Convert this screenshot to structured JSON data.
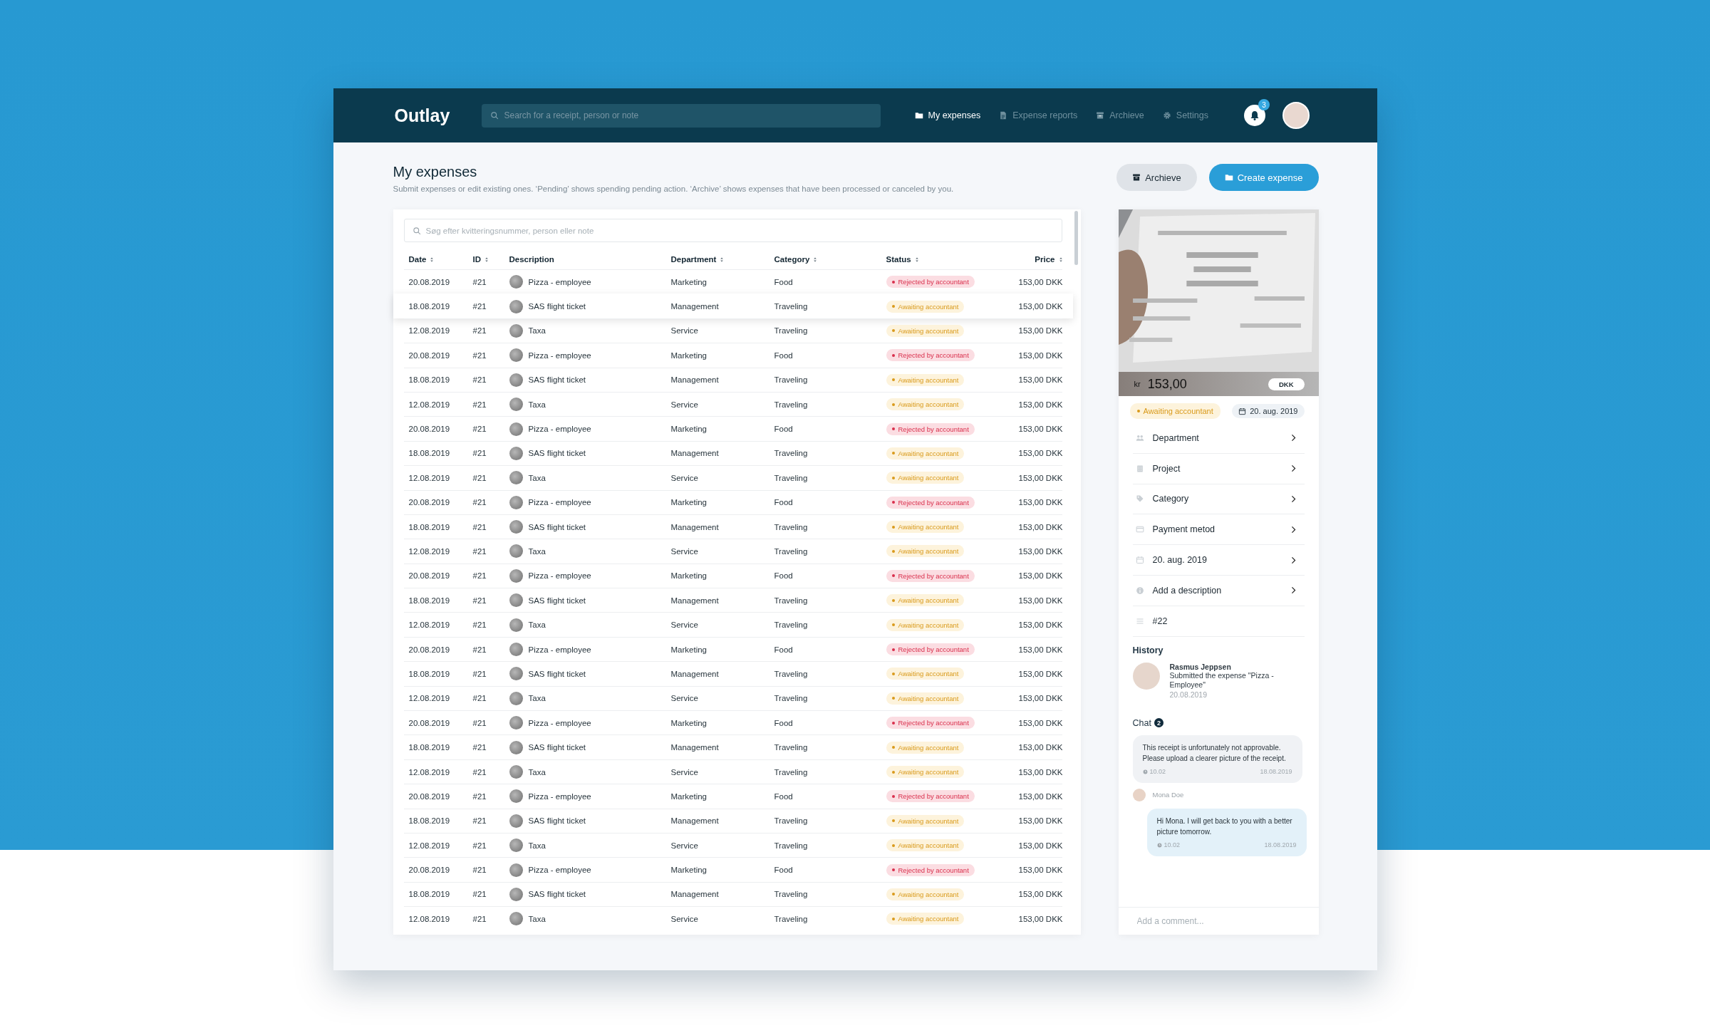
{
  "app": {
    "logo": "Outlay",
    "search_placeholder": "Search for a receipt, person or note",
    "nav": [
      {
        "label": "My expenses",
        "selected": true
      },
      {
        "label": "Expense reports",
        "selected": false
      },
      {
        "label": "Archieve",
        "selected": false
      },
      {
        "label": "Settings",
        "selected": false
      }
    ],
    "notifications": "3"
  },
  "page": {
    "title": "My expenses",
    "subtitle": "Submit expenses or edit existing ones. ‘Pending’ shows spending pending action. ‘Archive’ shows expenses that have been processed or canceled by you.",
    "buttons": [
      {
        "label": "Archieve",
        "kind": "secondary"
      },
      {
        "label": "Create expense",
        "kind": "primary"
      }
    ]
  },
  "table": {
    "search_placeholder": "Søg efter kvitteringsnummer, person eller note",
    "columns": [
      {
        "label": "Date",
        "sortable": true
      },
      {
        "label": "ID",
        "sortable": true
      },
      {
        "label": "Description",
        "sortable": false
      },
      {
        "label": "Department",
        "sortable": true
      },
      {
        "label": "Category",
        "sortable": true
      },
      {
        "label": "Status",
        "sortable": true
      },
      {
        "label": "Price",
        "sortable": true
      }
    ],
    "rows": [
      {
        "date": "20.08.2019",
        "id": "#21",
        "description": "Pizza - employee",
        "department": "Marketing",
        "category": "Food",
        "status": {
          "label": "Rejected by accountant",
          "kind": "rejected"
        },
        "price": "153,00 DKK",
        "selected": false
      },
      {
        "date": "18.08.2019",
        "id": "#21",
        "description": "SAS flight ticket",
        "department": "Management",
        "category": "Traveling",
        "status": {
          "label": "Awaiting accountant",
          "kind": "awaiting"
        },
        "price": "153,00 DKK",
        "selected": true
      },
      {
        "date": "12.08.2019",
        "id": "#21",
        "description": "Taxa",
        "department": "Service",
        "category": "Traveling",
        "status": {
          "label": "Awaiting accountant",
          "kind": "awaiting"
        },
        "price": "153,00 DKK",
        "selected": false
      },
      {
        "date": "20.08.2019",
        "id": "#21",
        "description": "Pizza - employee",
        "department": "Marketing",
        "category": "Food",
        "status": {
          "label": "Rejected by accountant",
          "kind": "rejected"
        },
        "price": "153,00 DKK",
        "selected": false
      },
      {
        "date": "18.08.2019",
        "id": "#21",
        "description": "SAS flight ticket",
        "department": "Management",
        "category": "Traveling",
        "status": {
          "label": "Awaiting accountant",
          "kind": "awaiting"
        },
        "price": "153,00 DKK",
        "selected": false
      },
      {
        "date": "12.08.2019",
        "id": "#21",
        "description": "Taxa",
        "department": "Service",
        "category": "Traveling",
        "status": {
          "label": "Awaiting accountant",
          "kind": "awaiting"
        },
        "price": "153,00 DKK",
        "selected": false
      },
      {
        "date": "20.08.2019",
        "id": "#21",
        "description": "Pizza - employee",
        "department": "Marketing",
        "category": "Food",
        "status": {
          "label": "Rejected by accountant",
          "kind": "rejected"
        },
        "price": "153,00 DKK",
        "selected": false
      },
      {
        "date": "18.08.2019",
        "id": "#21",
        "description": "SAS flight ticket",
        "department": "Management",
        "category": "Traveling",
        "status": {
          "label": "Awaiting accountant",
          "kind": "awaiting"
        },
        "price": "153,00 DKK",
        "selected": false
      },
      {
        "date": "12.08.2019",
        "id": "#21",
        "description": "Taxa",
        "department": "Service",
        "category": "Traveling",
        "status": {
          "label": "Awaiting accountant",
          "kind": "awaiting"
        },
        "price": "153,00 DKK",
        "selected": false
      },
      {
        "date": "20.08.2019",
        "id": "#21",
        "description": "Pizza - employee",
        "department": "Marketing",
        "category": "Food",
        "status": {
          "label": "Rejected by accountant",
          "kind": "rejected"
        },
        "price": "153,00 DKK",
        "selected": false
      },
      {
        "date": "18.08.2019",
        "id": "#21",
        "description": "SAS flight ticket",
        "department": "Management",
        "category": "Traveling",
        "status": {
          "label": "Awaiting accountant",
          "kind": "awaiting"
        },
        "price": "153,00 DKK",
        "selected": false
      },
      {
        "date": "12.08.2019",
        "id": "#21",
        "description": "Taxa",
        "department": "Service",
        "category": "Traveling",
        "status": {
          "label": "Awaiting accountant",
          "kind": "awaiting"
        },
        "price": "153,00 DKK",
        "selected": false
      },
      {
        "date": "20.08.2019",
        "id": "#21",
        "description": "Pizza - employee",
        "department": "Marketing",
        "category": "Food",
        "status": {
          "label": "Rejected by accountant",
          "kind": "rejected"
        },
        "price": "153,00 DKK",
        "selected": false
      },
      {
        "date": "18.08.2019",
        "id": "#21",
        "description": "SAS flight ticket",
        "department": "Management",
        "category": "Traveling",
        "status": {
          "label": "Awaiting accountant",
          "kind": "awaiting"
        },
        "price": "153,00 DKK",
        "selected": false
      },
      {
        "date": "12.08.2019",
        "id": "#21",
        "description": "Taxa",
        "department": "Service",
        "category": "Traveling",
        "status": {
          "label": "Awaiting accountant",
          "kind": "awaiting"
        },
        "price": "153,00 DKK",
        "selected": false
      },
      {
        "date": "20.08.2019",
        "id": "#21",
        "description": "Pizza - employee",
        "department": "Marketing",
        "category": "Food",
        "status": {
          "label": "Rejected by accountant",
          "kind": "rejected"
        },
        "price": "153,00 DKK",
        "selected": false
      },
      {
        "date": "18.08.2019",
        "id": "#21",
        "description": "SAS flight ticket",
        "department": "Management",
        "category": "Traveling",
        "status": {
          "label": "Awaiting accountant",
          "kind": "awaiting"
        },
        "price": "153,00 DKK",
        "selected": false
      },
      {
        "date": "12.08.2019",
        "id": "#21",
        "description": "Taxa",
        "department": "Service",
        "category": "Traveling",
        "status": {
          "label": "Awaiting accountant",
          "kind": "awaiting"
        },
        "price": "153,00 DKK",
        "selected": false
      },
      {
        "date": "20.08.2019",
        "id": "#21",
        "description": "Pizza - employee",
        "department": "Marketing",
        "category": "Food",
        "status": {
          "label": "Rejected by accountant",
          "kind": "rejected"
        },
        "price": "153,00 DKK",
        "selected": false
      },
      {
        "date": "18.08.2019",
        "id": "#21",
        "description": "SAS flight ticket",
        "department": "Management",
        "category": "Traveling",
        "status": {
          "label": "Awaiting accountant",
          "kind": "awaiting"
        },
        "price": "153,00 DKK",
        "selected": false
      },
      {
        "date": "12.08.2019",
        "id": "#21",
        "description": "Taxa",
        "department": "Service",
        "category": "Traveling",
        "status": {
          "label": "Awaiting accountant",
          "kind": "awaiting"
        },
        "price": "153,00 DKK",
        "selected": false
      },
      {
        "date": "20.08.2019",
        "id": "#21",
        "description": "Pizza - employee",
        "department": "Marketing",
        "category": "Food",
        "status": {
          "label": "Rejected by accountant",
          "kind": "rejected"
        },
        "price": "153,00 DKK",
        "selected": false
      },
      {
        "date": "18.08.2019",
        "id": "#21",
        "description": "SAS flight ticket",
        "department": "Management",
        "category": "Traveling",
        "status": {
          "label": "Awaiting accountant",
          "kind": "awaiting"
        },
        "price": "153,00 DKK",
        "selected": false
      },
      {
        "date": "12.08.2019",
        "id": "#21",
        "description": "Taxa",
        "department": "Service",
        "category": "Traveling",
        "status": {
          "label": "Awaiting accountant",
          "kind": "awaiting"
        },
        "price": "153,00 DKK",
        "selected": false
      },
      {
        "date": "20.08.2019",
        "id": "#21",
        "description": "Pizza - employee",
        "department": "Marketing",
        "category": "Food",
        "status": {
          "label": "Rejected by accountant",
          "kind": "rejected"
        },
        "price": "153,00 DKK",
        "selected": false
      },
      {
        "date": "18.08.2019",
        "id": "#21",
        "description": "SAS flight ticket",
        "department": "Management",
        "category": "Traveling",
        "status": {
          "label": "Awaiting accountant",
          "kind": "awaiting"
        },
        "price": "153,00 DKK",
        "selected": false
      },
      {
        "date": "12.08.2019",
        "id": "#21",
        "description": "Taxa",
        "department": "Service",
        "category": "Traveling",
        "status": {
          "label": "Awaiting accountant",
          "kind": "awaiting"
        },
        "price": "153,00 DKK",
        "selected": false
      }
    ]
  },
  "detail": {
    "amount_prefix": "kr",
    "amount": "153,00",
    "currency": "DKK",
    "status": {
      "label": "Awaiting accountant",
      "kind": "awaiting"
    },
    "date": "20. aug. 2019",
    "fields": [
      {
        "label": "Department",
        "chevron": true
      },
      {
        "label": "Project",
        "chevron": true
      },
      {
        "label": "Category",
        "chevron": true
      },
      {
        "label": "Payment metod",
        "chevron": true
      },
      {
        "label": "20. aug. 2019",
        "chevron": true
      },
      {
        "label": "Add a description",
        "chevron": true
      },
      {
        "label": "#22",
        "chevron": false
      }
    ],
    "history_title": "History",
    "history": [
      {
        "name": "Rasmus Jeppsen",
        "text": "Submitted the expense \"Pizza - Employee\"",
        "date": "20.08.2019"
      }
    ],
    "chat_title": "Chat",
    "chat_count": "2",
    "messages": [
      {
        "kind": "incoming",
        "text": "This receipt is unfortunately not approvable. Please upload a clearer picture of the receipt.",
        "time": "10.02",
        "date": "18.08.2019",
        "author": "Mona Doe"
      },
      {
        "kind": "outgoing",
        "text": "Hi Mona. I will get back to you with a better picture tomorrow.",
        "time": "10.02",
        "date": "18.08.2019"
      }
    ],
    "comment_placeholder": "Add a comment..."
  }
}
